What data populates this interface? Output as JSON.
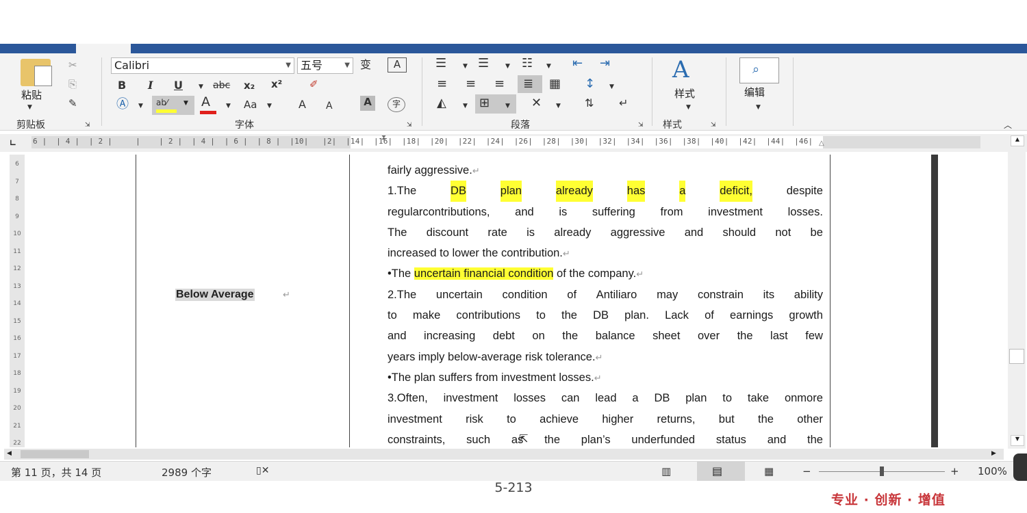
{
  "ribbon": {
    "clipboard": {
      "paste_label": "粘贴",
      "group_label": "剪贴板"
    },
    "font": {
      "font_name": "Calibri",
      "font_size": "五号",
      "group_label": "字体",
      "buttons": {
        "bold": "B",
        "italic": "I",
        "underline": "U",
        "strike": "abc",
        "subscript": "x₂",
        "superscript": "x²",
        "change_case": "Aa",
        "grow": "A",
        "shrink": "A",
        "font_color": "A"
      }
    },
    "paragraph": {
      "group_label": "段落"
    },
    "styles": {
      "label": "样式",
      "group_label": "样式"
    },
    "editing": {
      "label": "编辑"
    }
  },
  "ruler": {
    "ticks": "6 |  | 4 |  | 2 |     |    | 2 |  | 4 |  | 6 |  | 8 |  |10|   |2|  |14|  |16|  |18|  |20|  |22|  |24|  |26|  |28|  |30|  |32|  |34|  |36|  |38|  |40|  |42|  |44|  |46|",
    "vertical": [
      "6",
      "7",
      "8",
      "9",
      "10",
      "11",
      "12",
      "13",
      "14",
      "15",
      "16",
      "17",
      "18",
      "19",
      "20",
      "21",
      "22"
    ]
  },
  "document": {
    "left_cell": "Below Average",
    "lines": [
      {
        "segments": [
          {
            "t": "fairly aggressive."
          }
        ],
        "mark": "↵"
      },
      {
        "justify": true,
        "segments": [
          {
            "t": "1.The"
          },
          {
            "t": "DB",
            "hl": true
          },
          {
            "t": "plan",
            "hl": true
          },
          {
            "t": "already",
            "hl": true
          },
          {
            "t": "has",
            "hl": true
          },
          {
            "t": "a",
            "hl": true
          },
          {
            "t": "deficit,",
            "hl": true
          },
          {
            "t": "despite"
          }
        ]
      },
      {
        "justify": true,
        "segments": [
          {
            "t": "regularcontributions,"
          },
          {
            "t": "and"
          },
          {
            "t": "is"
          },
          {
            "t": "suffering"
          },
          {
            "t": "from"
          },
          {
            "t": "investment"
          },
          {
            "t": "losses."
          }
        ]
      },
      {
        "justify": true,
        "segments": [
          {
            "t": "The"
          },
          {
            "t": "discount"
          },
          {
            "t": "rate"
          },
          {
            "t": "is"
          },
          {
            "t": "already"
          },
          {
            "t": "aggressive"
          },
          {
            "t": "and"
          },
          {
            "t": "should"
          },
          {
            "t": "not"
          },
          {
            "t": "be"
          }
        ]
      },
      {
        "segments": [
          {
            "t": "increased to lower the contribution."
          }
        ],
        "mark": "↵"
      },
      {
        "segments": [
          {
            "t": "•The "
          },
          {
            "t": "uncertain financial condition",
            "hl": true
          },
          {
            "t": " of the company."
          }
        ],
        "mark": "↵"
      },
      {
        "justify": true,
        "segments": [
          {
            "t": "2.The"
          },
          {
            "t": "uncertain"
          },
          {
            "t": "condition"
          },
          {
            "t": "of"
          },
          {
            "t": "Antiliaro"
          },
          {
            "t": "may"
          },
          {
            "t": "constrain"
          },
          {
            "t": "its"
          },
          {
            "t": "ability"
          }
        ]
      },
      {
        "justify": true,
        "segments": [
          {
            "t": "to"
          },
          {
            "t": "make"
          },
          {
            "t": "contributions"
          },
          {
            "t": "to"
          },
          {
            "t": "the"
          },
          {
            "t": "DB"
          },
          {
            "t": "plan."
          },
          {
            "t": "Lack"
          },
          {
            "t": "of"
          },
          {
            "t": "earnings"
          },
          {
            "t": "growth"
          }
        ]
      },
      {
        "justify": true,
        "segments": [
          {
            "t": "and"
          },
          {
            "t": "increasing"
          },
          {
            "t": "debt"
          },
          {
            "t": "on"
          },
          {
            "t": "the"
          },
          {
            "t": "balance"
          },
          {
            "t": "sheet"
          },
          {
            "t": "over"
          },
          {
            "t": "the"
          },
          {
            "t": "last"
          },
          {
            "t": "few"
          }
        ]
      },
      {
        "segments": [
          {
            "t": "years imply below-average risk tolerance."
          }
        ],
        "mark": "↵"
      },
      {
        "segments": [
          {
            "t": "•The plan suffers from investment losses."
          }
        ],
        "mark": "↵"
      },
      {
        "justify": true,
        "segments": [
          {
            "t": "3.Often,"
          },
          {
            "t": "investment"
          },
          {
            "t": "losses"
          },
          {
            "t": "can"
          },
          {
            "t": "lead"
          },
          {
            "t": "a"
          },
          {
            "t": "DB"
          },
          {
            "t": "plan"
          },
          {
            "t": "to"
          },
          {
            "t": "take"
          },
          {
            "t": "onmore"
          }
        ]
      },
      {
        "justify": true,
        "segments": [
          {
            "t": "investment"
          },
          {
            "t": "risk"
          },
          {
            "t": "to"
          },
          {
            "t": "achieve"
          },
          {
            "t": "higher"
          },
          {
            "t": "returns,"
          },
          {
            "t": "but"
          },
          {
            "t": "the"
          },
          {
            "t": "other"
          }
        ]
      },
      {
        "justify": true,
        "segments": [
          {
            "t": "constraints,"
          },
          {
            "t": "such"
          },
          {
            "t": "as"
          },
          {
            "t": "the"
          },
          {
            "t": "plan’s"
          },
          {
            "t": "underfunded"
          },
          {
            "t": "status"
          },
          {
            "t": "and"
          },
          {
            "t": "the"
          }
        ]
      }
    ]
  },
  "status": {
    "page": "第 11 页，共 14 页",
    "words": "2989 个字",
    "zoom": "100%",
    "zoom_minus": "−",
    "zoom_plus": "+"
  },
  "footer": {
    "page_number": "5-213",
    "slogan": "专业 · 创新 · 增值"
  },
  "colors": {
    "highlight": "#ffff33",
    "title_bar": "#2b579a",
    "slogan": "#c8363a"
  }
}
